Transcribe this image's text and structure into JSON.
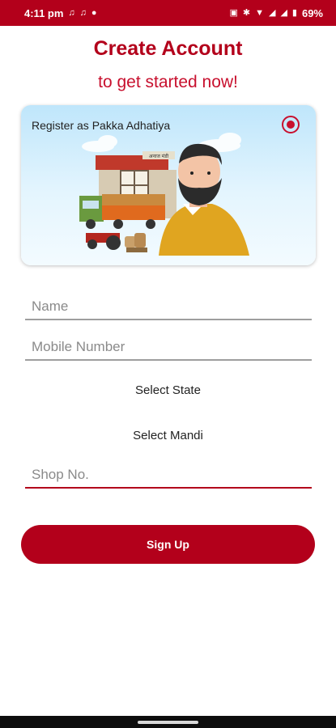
{
  "status_bar": {
    "time": "4:11 pm",
    "battery": "69%",
    "left_icons": [
      "notification-icon",
      "notification-icon",
      "dot-icon"
    ],
    "right_icons": [
      "network-icon",
      "vibrate-icon",
      "wifi-icon",
      "signal-icon",
      "signal-icon",
      "battery-icon"
    ]
  },
  "header": {
    "title": "Create Account",
    "subtitle": "to get started now!"
  },
  "role_card": {
    "label": "Register as Pakka Adhatiya",
    "selected": true,
    "sign_text": "अनाज मंडी"
  },
  "form": {
    "name_placeholder": "Name",
    "mobile_placeholder": "Mobile Number",
    "select_state": "Select State",
    "select_mandi": "Select Mandi",
    "shop_placeholder": "Shop No."
  },
  "actions": {
    "signup_label": "Sign Up"
  },
  "colors": {
    "brand": "#b3001b",
    "accent": "#c8102e"
  }
}
